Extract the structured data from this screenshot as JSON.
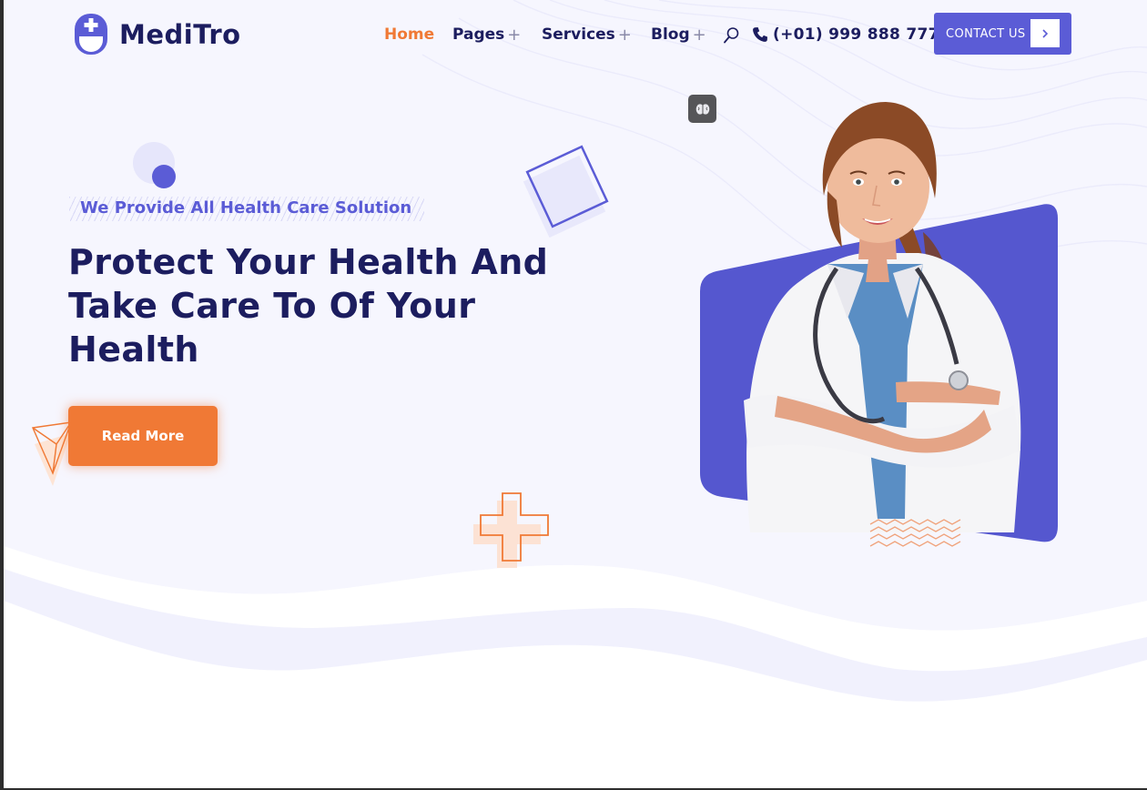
{
  "brand": {
    "name": "MediTro"
  },
  "nav": {
    "items": [
      {
        "label": "Home",
        "active": true,
        "has_submenu": false
      },
      {
        "label": "Pages",
        "active": false,
        "has_submenu": true
      },
      {
        "label": "Services",
        "active": false,
        "has_submenu": true
      },
      {
        "label": "Blog",
        "active": false,
        "has_submenu": true
      }
    ],
    "submenu_marker": "+",
    "search_icon": "search-icon",
    "phone": {
      "icon": "phone-icon",
      "number": "(+01) 999 888 777"
    },
    "contact_button": {
      "label": "CONTACT US",
      "icon": "chevron-right-icon"
    }
  },
  "hero": {
    "tagline": "We Provide All Health Care Solution",
    "headline_lines": [
      "Protect Your Health And",
      "Take Care To Of Your",
      "Health"
    ],
    "cta_label": "Read More",
    "badge_icon": "brain-icon"
  },
  "colors": {
    "primary": "#5b5cd6",
    "accent": "#f07935",
    "heading": "#1c1d5f",
    "hero_background": "#f6f6fe"
  }
}
